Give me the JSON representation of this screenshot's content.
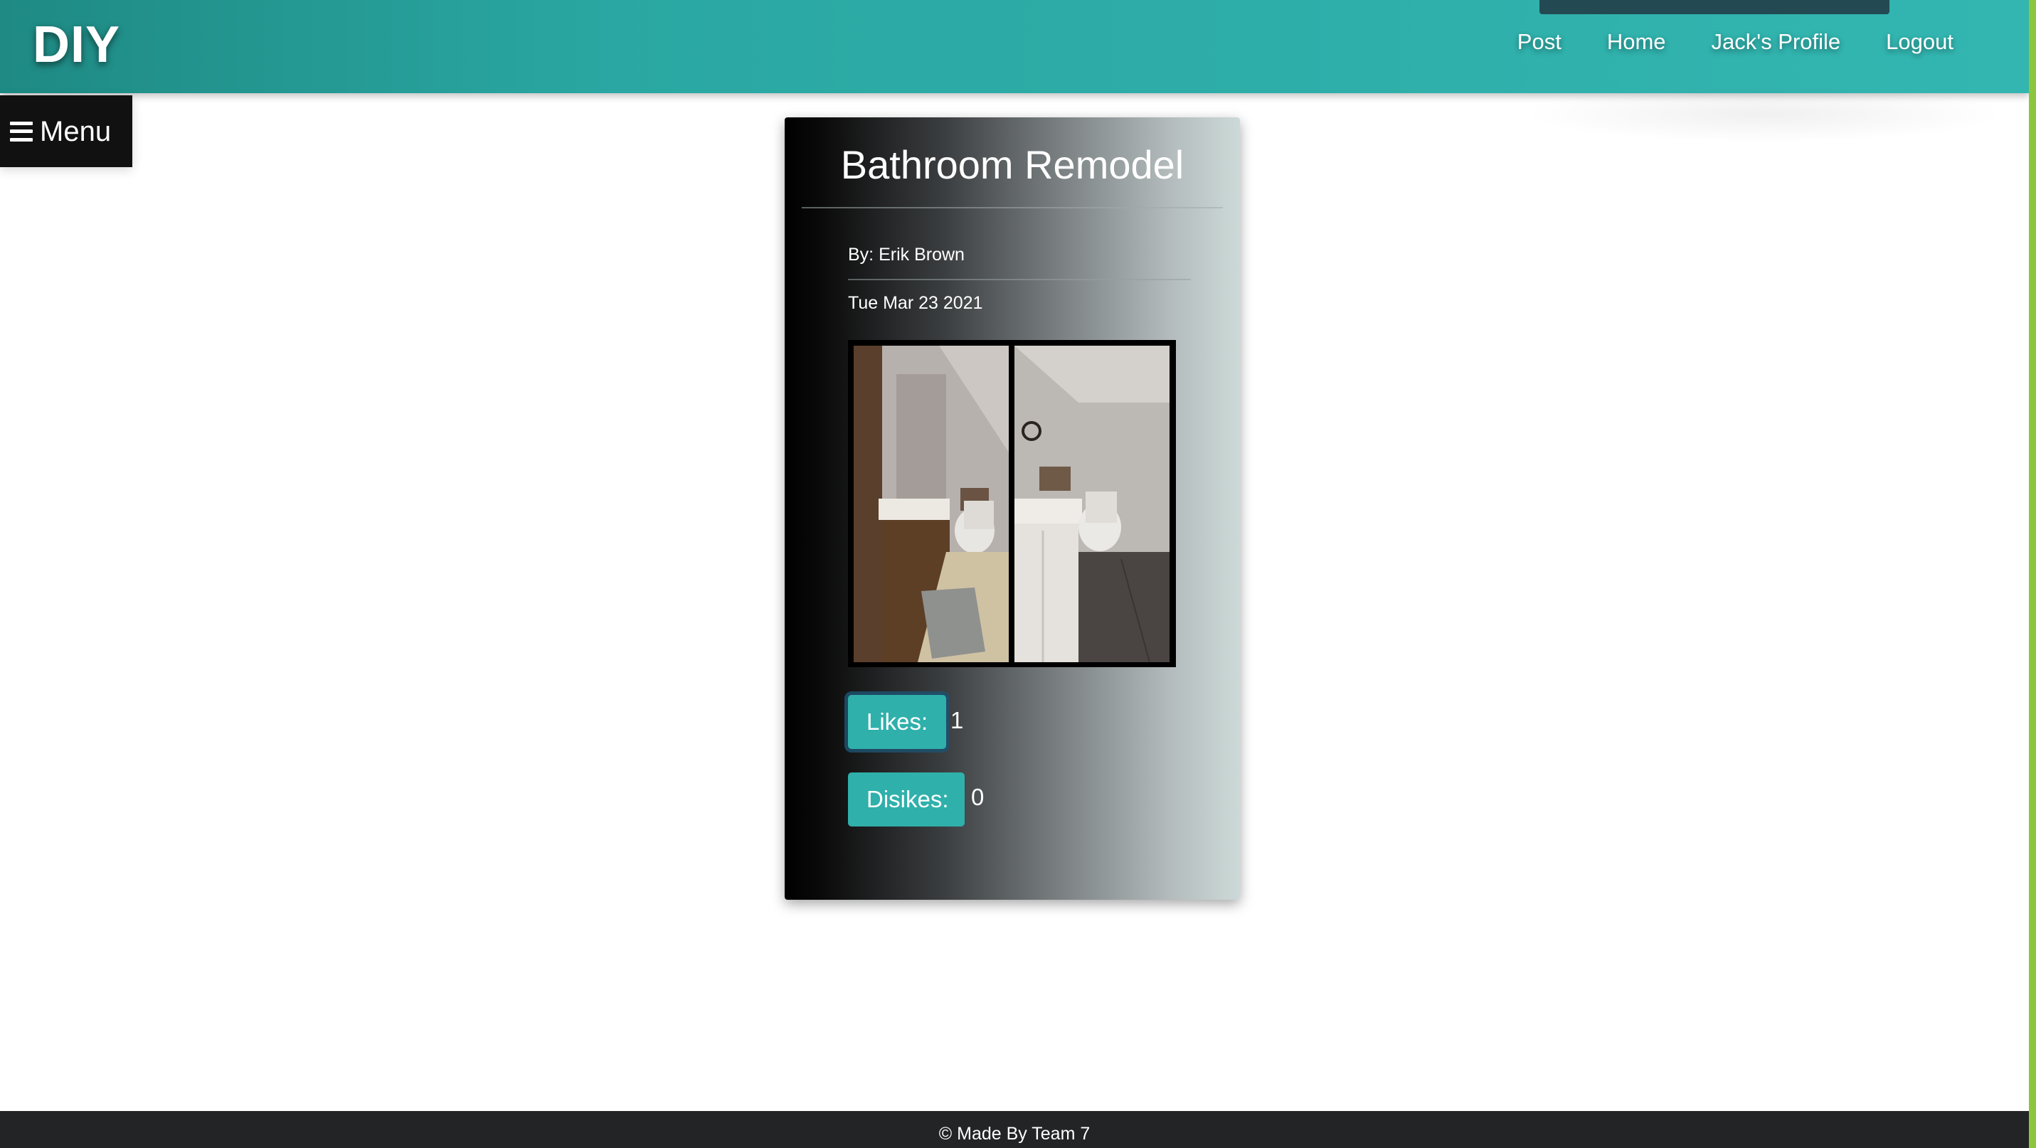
{
  "header": {
    "brand": "DIY",
    "nav": {
      "post": "Post",
      "home": "Home",
      "profile": "Jack's Profile",
      "logout": "Logout"
    }
  },
  "menu": {
    "label": "Menu",
    "icon": "hamburger-icon"
  },
  "post": {
    "title": "Bathroom Remodel",
    "author": "By: Erik Brown",
    "date": "Tue Mar 23 2021",
    "likes_label": "Likes:",
    "likes_count": "1",
    "dislikes_label": "Disikes:",
    "dislikes_count": "0"
  },
  "footer": {
    "text": "© Made By Team 7"
  },
  "colors": {
    "navbar": "#2aa7a2",
    "accent_button": "#2fb0ab",
    "footer": "#222426",
    "right_edge": "#8cc63f"
  }
}
